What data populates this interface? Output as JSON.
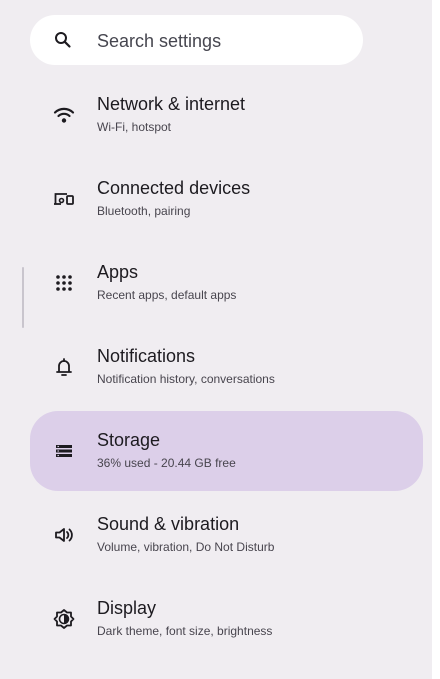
{
  "search": {
    "placeholder": "Search settings",
    "icon": "search-icon"
  },
  "settings": [
    {
      "icon": "wifi-icon",
      "title": "Network & internet",
      "subtitle": "Wi-Fi, hotspot",
      "selected": false
    },
    {
      "icon": "connected-devices-icon",
      "title": "Connected devices",
      "subtitle": "Bluetooth, pairing",
      "selected": false
    },
    {
      "icon": "apps-grid-icon",
      "title": "Apps",
      "subtitle": "Recent apps, default apps",
      "selected": false
    },
    {
      "icon": "bell-icon",
      "title": "Notifications",
      "subtitle": "Notification history, conversations",
      "selected": false
    },
    {
      "icon": "storage-icon",
      "title": "Storage",
      "subtitle": "36% used - 20.44 GB free",
      "selected": true
    },
    {
      "icon": "volume-icon",
      "title": "Sound & vibration",
      "subtitle": "Volume, vibration, Do Not Disturb",
      "selected": false
    },
    {
      "icon": "display-brightness-icon",
      "title": "Display",
      "subtitle": "Dark theme, font size, brightness",
      "selected": false
    }
  ],
  "colors": {
    "background": "#f0edf1",
    "selected_item": "#dccfe9",
    "search_field": "#ffffff",
    "text_primary": "#1d1b20",
    "text_secondary": "#48454e"
  }
}
